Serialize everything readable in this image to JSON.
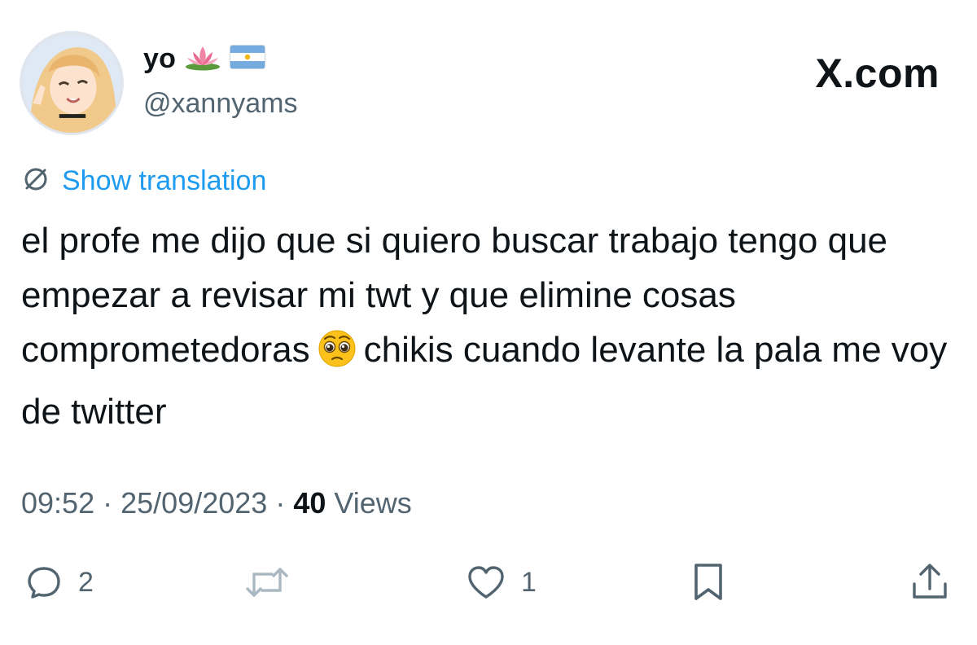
{
  "author": {
    "display_name": "yo",
    "name_icons": [
      "lotus-icon",
      "argentina-flag-icon"
    ],
    "handle": "@xannyams"
  },
  "brand": "X.com",
  "translation": {
    "icon": "globe-icon",
    "label": "Show translation"
  },
  "tweet": {
    "text_part1": "el profe me dijo que si quiero buscar trabajo tengo que empezar a revisar mi twt y que elimine cosas comprometedoras",
    "emoji": "pleading-face-icon",
    "text_part2": "chikis cuando levante la pala me voy de twitter"
  },
  "meta": {
    "time": "09:52",
    "separator": "·",
    "date": "25/09/2023",
    "views_count": "40",
    "views_label": "Views"
  },
  "actions": {
    "reply_count": "2",
    "retweet_count": "",
    "like_count": "1"
  },
  "colors": {
    "accent": "#1d9bf0",
    "secondary_text": "#536471",
    "primary_text": "#0f1419",
    "retweet_disabled": "#aab8c2"
  }
}
